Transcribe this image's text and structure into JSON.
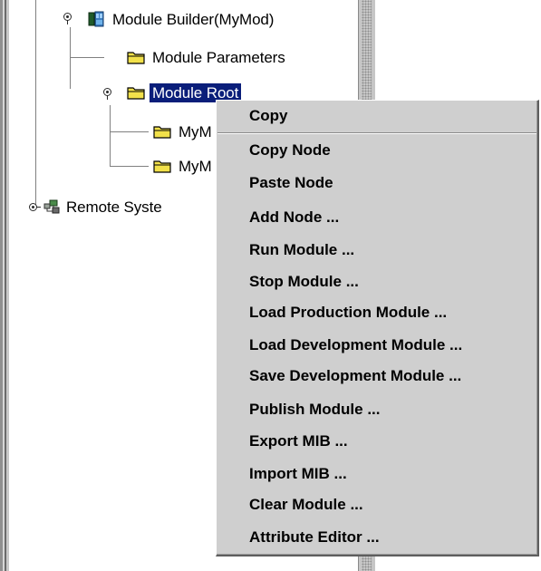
{
  "tree": {
    "root_label": "Module Builder(MyMod)",
    "module_parameters_label": "Module Parameters",
    "module_root_label": "Module Root",
    "child1_label": "MyM",
    "child2_label": "MyM",
    "remote_label": "Remote Syste"
  },
  "context_menu": {
    "items": [
      "Copy",
      "Copy Node",
      "Paste Node",
      "Add Node ...",
      "Run Module ...",
      "Stop Module ...",
      "Load Production Module ...",
      "Load Development Module ...",
      "Save Development Module ...",
      "Publish Module ...",
      "Export MIB ...",
      "Import MIB ...",
      "Clear Module ...",
      "Attribute Editor ..."
    ]
  },
  "colors": {
    "selection": "#0a1e7a",
    "menu_bg": "#cfcfcf",
    "folder": "#f2e14a"
  }
}
